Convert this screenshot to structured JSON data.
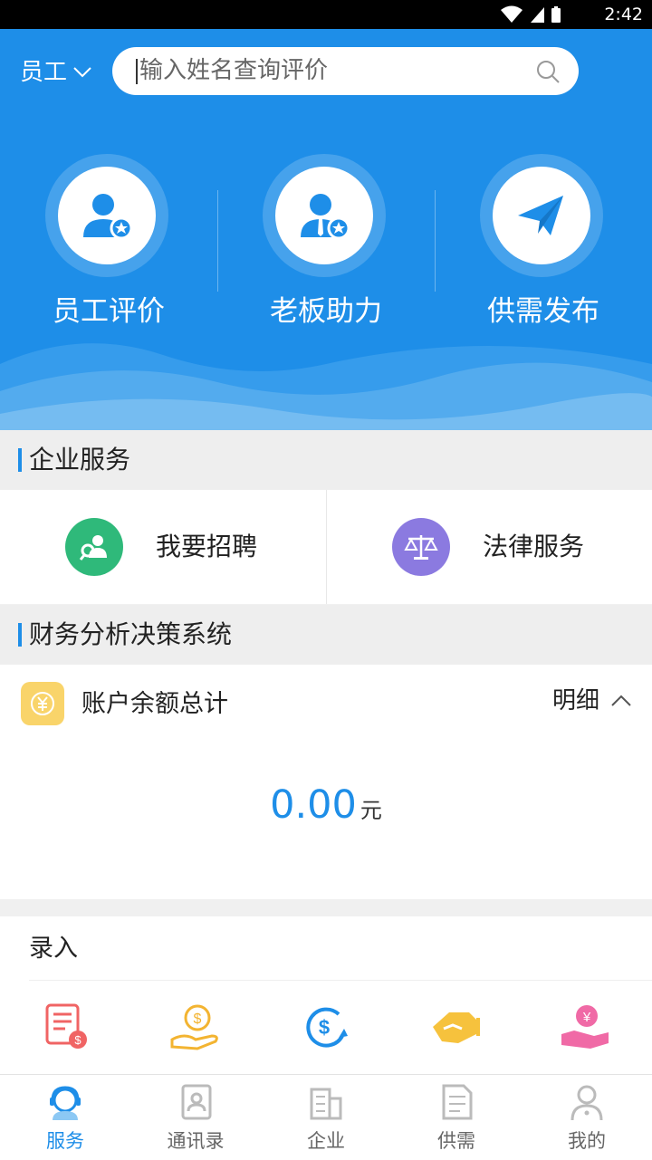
{
  "status_bar": {
    "time": "2:42"
  },
  "header": {
    "role_label": "员工",
    "search_placeholder": "输入姓名查询评价"
  },
  "features": [
    {
      "label": "员工评价",
      "icon": "employee-star-icon"
    },
    {
      "label": "老板助力",
      "icon": "boss-star-icon"
    },
    {
      "label": "供需发布",
      "icon": "paper-plane-icon"
    }
  ],
  "enterprise_services": {
    "title": "企业服务",
    "items": [
      {
        "label": "我要招聘",
        "icon": "recruit-icon",
        "color": "#2fb97a"
      },
      {
        "label": "法律服务",
        "icon": "scales-icon",
        "color": "#8b7ae0"
      }
    ]
  },
  "finance": {
    "section_title": "财务分析决策系统",
    "balance_title": "账户余额总计",
    "detail_label": "明细",
    "amount": "0.00",
    "unit": "元"
  },
  "entry": {
    "title": "录入",
    "icons": [
      "bill-icon",
      "coin-hand-icon",
      "dollar-cycle-icon",
      "tag-hand-icon",
      "yuan-hand-icon"
    ]
  },
  "tabbar": {
    "tabs": [
      {
        "label": "服务",
        "icon": "service-icon",
        "active": true
      },
      {
        "label": "通讯录",
        "icon": "contacts-icon",
        "active": false
      },
      {
        "label": "企业",
        "icon": "building-icon",
        "active": false
      },
      {
        "label": "供需",
        "icon": "document-icon",
        "active": false
      },
      {
        "label": "我的",
        "icon": "user-icon",
        "active": false
      }
    ]
  },
  "colors": {
    "primary": "#1e8ee8",
    "accent_yellow": "#f9d46a"
  }
}
